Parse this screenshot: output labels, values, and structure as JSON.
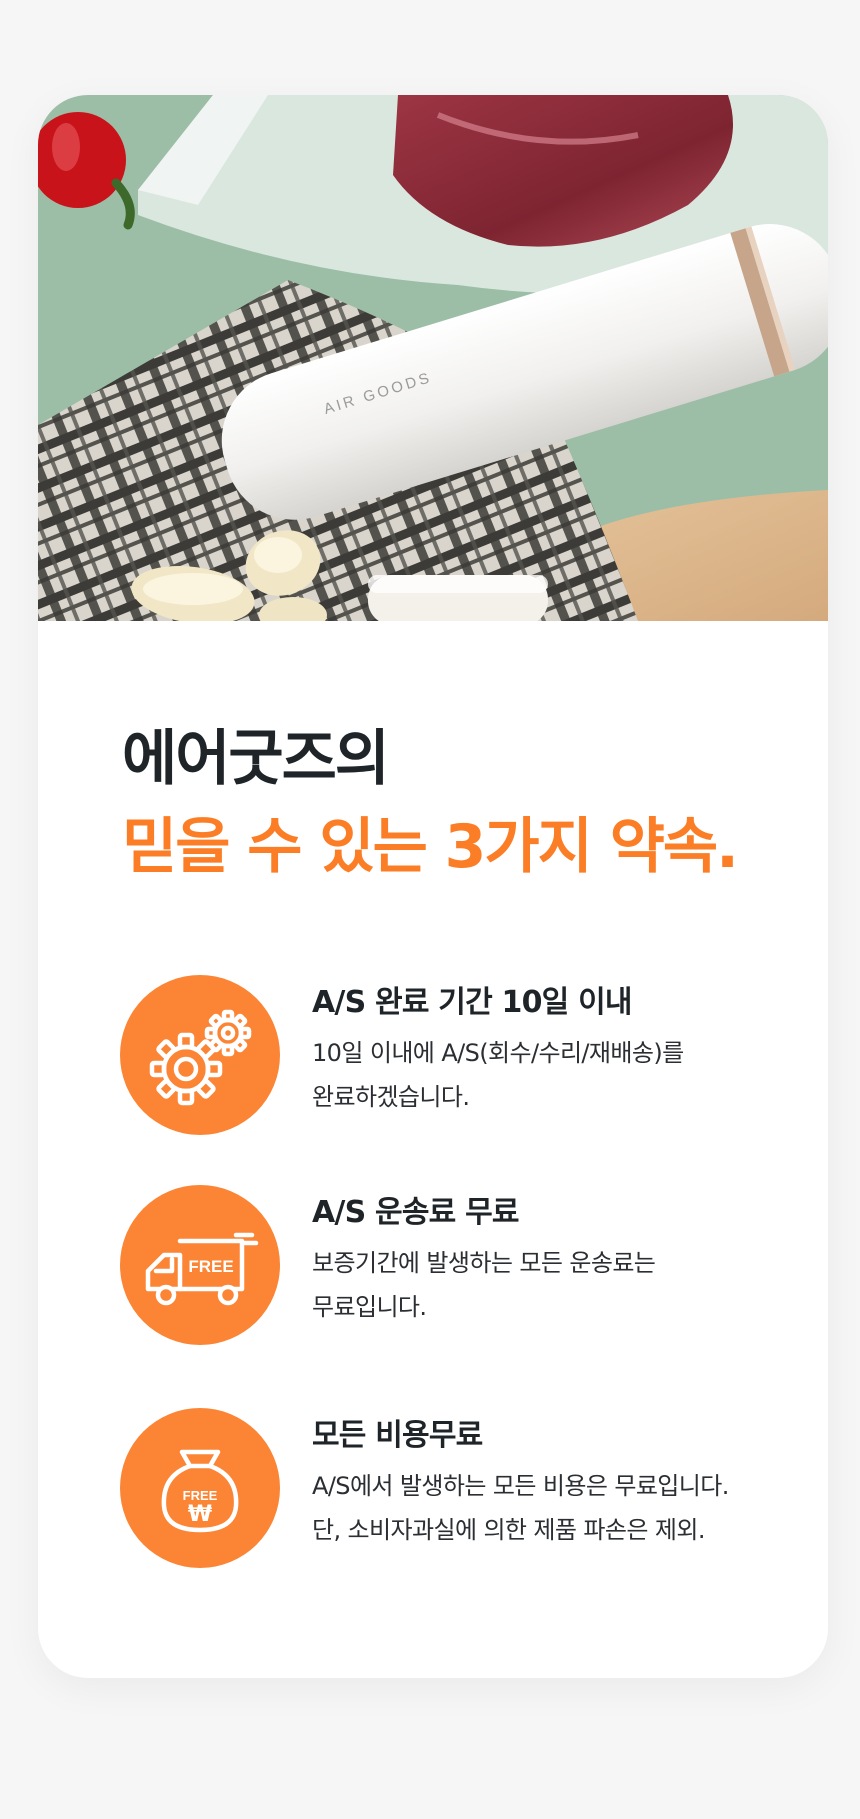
{
  "hero": {
    "brand_mark": "AIR GOODS"
  },
  "heading": {
    "line1": "에어굿즈의",
    "line2": "믿을 수 있는 3가지 약속."
  },
  "features": [
    {
      "icon": "gears-icon",
      "title": "A/S 완료 기간 10일 이내",
      "desc_line1": "10일 이내에 A/S(회수/수리/재배송)를",
      "desc_line2": "완료하겠습니다."
    },
    {
      "icon": "free-truck-icon",
      "icon_text": "FREE",
      "title": "A/S 운송료 무료",
      "desc_line1": "보증기간에 발생하는 모든 운송료는",
      "desc_line2": "무료입니다."
    },
    {
      "icon": "money-bag-icon",
      "icon_text": "FREE",
      "icon_symbol": "₩",
      "title": "모든 비용무료",
      "desc_line1": "A/S에서 발생하는 모든 비용은 무료입니다.",
      "desc_line2": "단, 소비자과실에 의한 제품 파손은 제외."
    }
  ],
  "colors": {
    "accent": "#fb7e26",
    "icon_bg": "#fb8534",
    "heading": "#1f2428",
    "background": "#f6f6f6",
    "card": "#ffffff"
  }
}
